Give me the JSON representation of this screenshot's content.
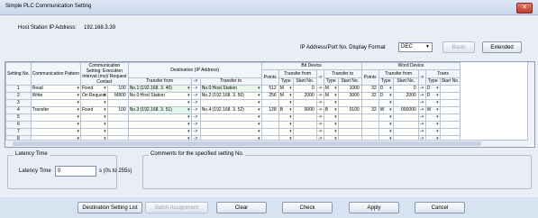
{
  "window": {
    "title": "Simple PLC Communication Setting",
    "close_glyph": "✕"
  },
  "host": {
    "label": "Host Station IP Address:",
    "value": "192.168.3.39"
  },
  "ipformat": {
    "label": "IP Address/Port No. Display Format",
    "value": "DEC"
  },
  "buttons": {
    "basic": "Basic",
    "extended": "Extended",
    "dest_list": "Destination Setting List",
    "batch": "Batch Assignment",
    "clear": "Clear",
    "check": "Check",
    "apply": "Apply",
    "cancel": "Cancel"
  },
  "table": {
    "headers": {
      "setting_no": "Setting No.",
      "comm_pattern": "Communication Pattern",
      "comm_setting": "Communication Setting: Execution Interval (ms)/ Request Contact",
      "destination": "Destination (IP Address)",
      "transfer_from": "Transfer from",
      "arrow": "->",
      "transfer_to": "Transfer to",
      "bit_device": "Bit Device",
      "points": "Points",
      "type": "Type",
      "start_no": "Start No.",
      "word_device": "Word Device",
      "trans_cut": "Trans"
    },
    "rows": [
      {
        "no": "1",
        "pattern": "Read",
        "setting": "Fixed",
        "interval": "100",
        "from": "No.1:(192.168. 3. 40)",
        "to": "No.0:Host Station",
        "bpoints": "512",
        "bftype": "M",
        "bfstart": "0",
        "bttype": "M",
        "btstart": "1000",
        "wpoints": "32",
        "wftype": "D",
        "wfstart": "0",
        "wttype": "D"
      },
      {
        "no": "2",
        "pattern": "Write",
        "setting": "On Request",
        "interval": "M800",
        "from": "No.0:Host Station",
        "to": "No.2:(192.168. 3. 50)",
        "bpoints": "256",
        "bftype": "M",
        "bfstart": "2000",
        "bttype": "M",
        "btstart": "3000",
        "wpoints": "32",
        "wftype": "D",
        "wfstart": "2000",
        "wttype": "D"
      },
      {
        "no": "3",
        "pattern": "",
        "setting": "",
        "interval": "",
        "from": "",
        "to": "",
        "bpoints": "",
        "bftype": "",
        "bfstart": "",
        "bttype": "",
        "btstart": "",
        "wpoints": "",
        "wftype": "",
        "wfstart": "",
        "wttype": ""
      },
      {
        "no": "4",
        "pattern": "Transfer",
        "setting": "Fixed",
        "interval": "100",
        "from": "No.3:(192.168. 3. 51)",
        "to": "No.4:(192.168. 3. 52)",
        "bpoints": "128",
        "bftype": "B",
        "bfstart": "0000",
        "bttype": "B",
        "btstart": "0100",
        "wpoints": "32",
        "wftype": "W",
        "wfstart": "000000",
        "wttype": "W"
      },
      {
        "no": "5",
        "pattern": "",
        "setting": "",
        "interval": "",
        "from": "",
        "to": "",
        "bpoints": "",
        "bftype": "",
        "bfstart": "",
        "bttype": "",
        "btstart": "",
        "wpoints": "",
        "wftype": "",
        "wfstart": "",
        "wttype": ""
      },
      {
        "no": "6",
        "pattern": "",
        "setting": "",
        "interval": "",
        "from": "",
        "to": "",
        "bpoints": "",
        "bftype": "",
        "bfstart": "",
        "bttype": "",
        "btstart": "",
        "wpoints": "",
        "wftype": "",
        "wfstart": "",
        "wttype": ""
      },
      {
        "no": "7",
        "pattern": "",
        "setting": "",
        "interval": "",
        "from": "",
        "to": "",
        "bpoints": "",
        "bftype": "",
        "bfstart": "",
        "bttype": "",
        "btstart": "",
        "wpoints": "",
        "wftype": "",
        "wfstart": "",
        "wttype": ""
      },
      {
        "no": "8",
        "pattern": "",
        "setting": "",
        "interval": "",
        "from": "",
        "to": "",
        "bpoints": "",
        "bftype": "",
        "bfstart": "",
        "bttype": "",
        "btstart": "",
        "wpoints": "",
        "wftype": "",
        "wfstart": "",
        "wttype": ""
      }
    ]
  },
  "latency": {
    "group_title": "Latency Time",
    "label": "Latency Time",
    "value": "0",
    "unit": "s (0s to 255s)"
  },
  "comments": {
    "title": "Comments for the specified setting No."
  }
}
